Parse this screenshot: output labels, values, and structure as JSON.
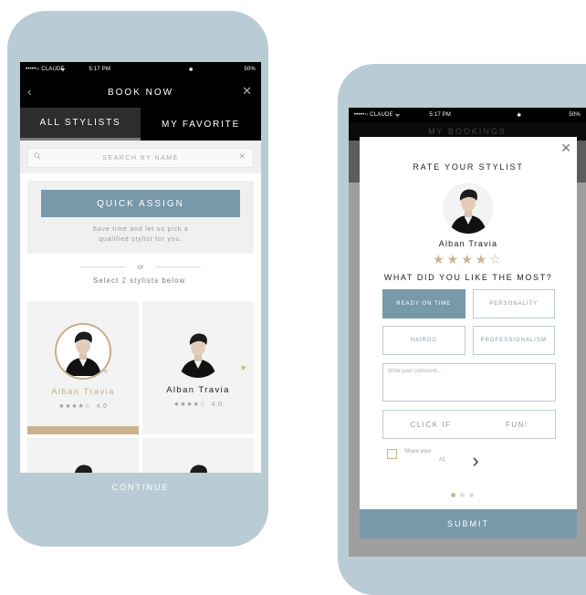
{
  "screen1": {
    "status": {
      "carrier": "•••••○ CLAUDE",
      "wifi": "ᯤ",
      "time": "5:17 PM",
      "bluetooth": "✱",
      "battery": "50%"
    },
    "nav": {
      "title": "BOOK NOW",
      "back": "‹",
      "close": "✕"
    },
    "tabs": [
      {
        "label": "ALL STYLISTS"
      },
      {
        "label": "MY FAVORITE"
      }
    ],
    "search": {
      "placeholder": "SEARCH BY NAME",
      "clear": "✕"
    },
    "assign": {
      "button": "QUICK ASSIGN",
      "text_line1": "Save time and let us pick a",
      "text_line2": "qualified stylist for you."
    },
    "or": "or",
    "select": {
      "prefix": "Select ",
      "count": "2",
      "suffix": " stylists below."
    },
    "stylists": [
      {
        "name": "Alban Travia",
        "stars": "★★★★☆",
        "rating": "4.0"
      },
      {
        "name": "Alban Travia",
        "stars": "★★★★☆",
        "rating": "4.0"
      }
    ],
    "heart": "♥",
    "continue": "CONTINUE"
  },
  "screen2": {
    "status": {
      "carrier": "•••••○ CLAUDE",
      "wifi": "ᯤ",
      "time": "5:17 PM",
      "bluetooth": "✱",
      "battery": "50%"
    },
    "nav": {
      "title": "MY BOOKINGS"
    },
    "modal": {
      "close": "✕",
      "title": "RATE YOUR STYLIST",
      "name": "Alban Travia",
      "stars": "★★★★☆",
      "question": "WHAT DID YOU LIKE THE MOST?",
      "chips": [
        "READY ON TIME",
        "PERSONALITY",
        "HAIRDO",
        "PROFESSIONALISM"
      ],
      "comment_placeholder": "Write your comment...",
      "click_fun": "CLICK IF                FUN!",
      "share_line1": "Share your                   tagram",
      "share_line2": "#1",
      "next": "›",
      "submit": "SUBMIT"
    }
  },
  "colors": {
    "accent": "#7899aa",
    "gold": "#c8b48b",
    "frame": "#b9cbd5"
  }
}
